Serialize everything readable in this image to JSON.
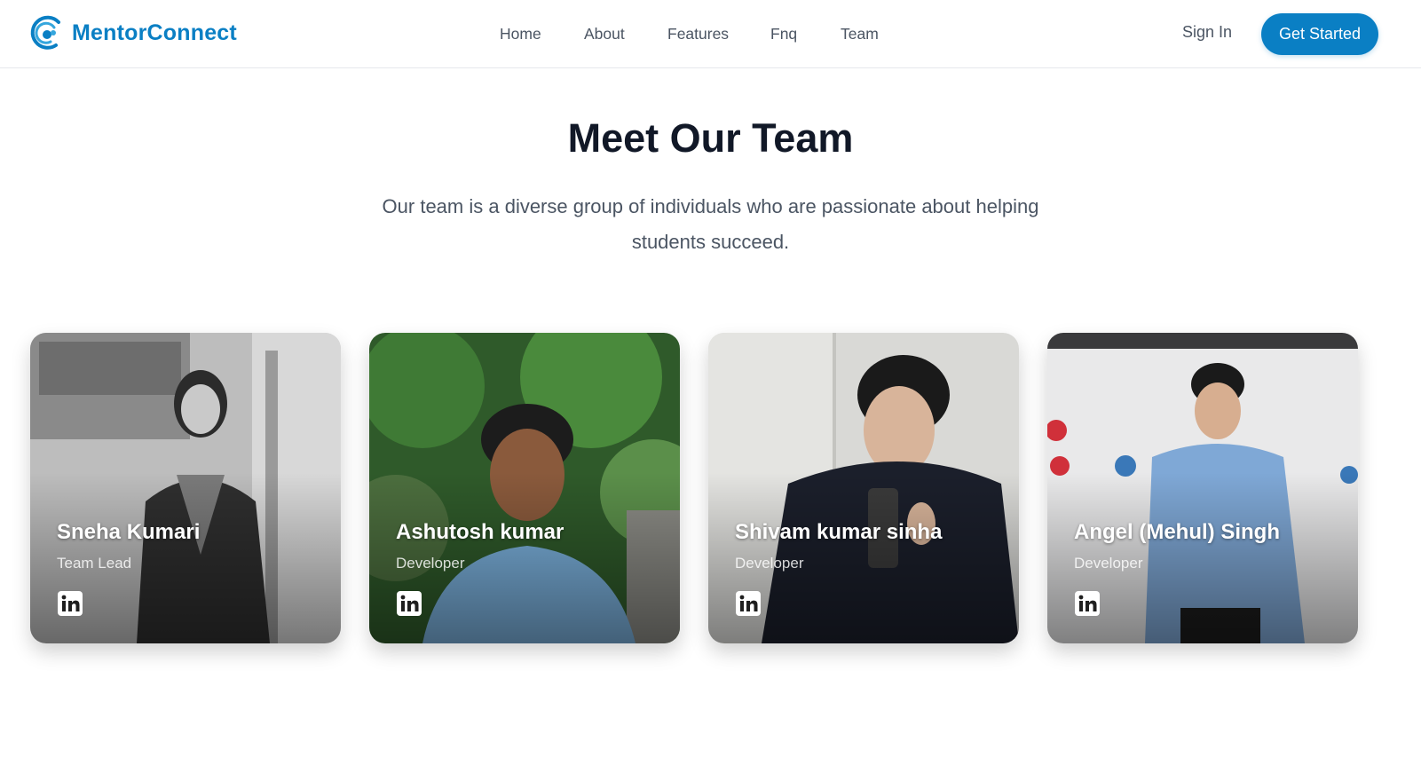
{
  "brand": {
    "name": "MentorConnect",
    "logo_icon": "mentor-connect-logo-icon",
    "color": "#0a7fc4"
  },
  "nav": {
    "links": [
      "Home",
      "About",
      "Features",
      "Fnq",
      "Team"
    ],
    "sign_in": "Sign In",
    "cta": "Get Started"
  },
  "hero": {
    "title": "Meet Our Team",
    "subtitle": "Our team is a diverse group of individuals who are passionate about helping students succeed."
  },
  "team": [
    {
      "name": "Sneha Kumari",
      "role": "Team Lead",
      "social_icon": "linkedin-icon"
    },
    {
      "name": "Ashutosh kumar",
      "role": "Developer",
      "social_icon": "linkedin-icon"
    },
    {
      "name": "Shivam kumar sinha",
      "role": "Developer",
      "social_icon": "linkedin-icon"
    },
    {
      "name": "Angel (Mehul) Singh",
      "role": "Developer",
      "social_icon": "linkedin-icon"
    }
  ],
  "colors": {
    "accent": "#0a7fc4",
    "heading": "#111827",
    "body_text": "#4b5563"
  }
}
